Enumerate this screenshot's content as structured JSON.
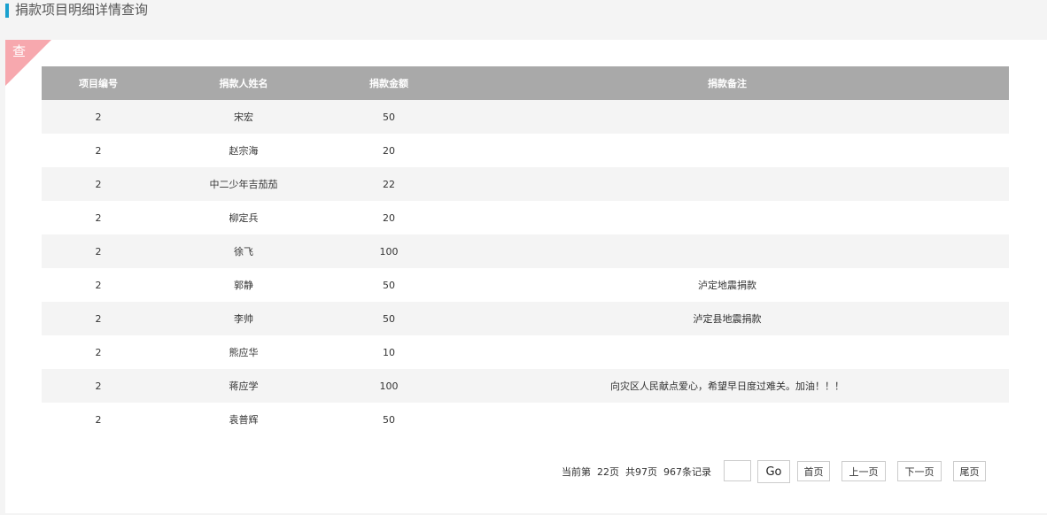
{
  "header": {
    "title": "捐款项目明细详情查询"
  },
  "panel": {
    "corner_label": "查"
  },
  "table": {
    "columns": [
      "项目编号",
      "捐款人姓名",
      "捐款金额",
      "捐款备注"
    ],
    "rows": [
      [
        "2",
        "宋宏",
        "50",
        ""
      ],
      [
        "2",
        "赵宗海",
        "20",
        ""
      ],
      [
        "2",
        "中二少年吉茄茄",
        "22",
        ""
      ],
      [
        "2",
        "柳定兵",
        "20",
        ""
      ],
      [
        "2",
        "徐飞",
        "100",
        ""
      ],
      [
        "2",
        "郭静",
        "50",
        "泸定地震捐款"
      ],
      [
        "2",
        "李帅",
        "50",
        "泸定县地震捐款"
      ],
      [
        "2",
        "熊应华",
        "10",
        ""
      ],
      [
        "2",
        "蒋应学",
        "100",
        "向灾区人民献点爱心，希望早日度过难关。加油！！！"
      ],
      [
        "2",
        "袁普辉",
        "50",
        ""
      ]
    ]
  },
  "pager": {
    "info": "当前第  22页  共97页  967条记录",
    "page_input_value": "",
    "go_label": "Go",
    "first_label": "首页",
    "prev_label": "上一页",
    "next_label": "下一页",
    "last_label": "尾页"
  }
}
